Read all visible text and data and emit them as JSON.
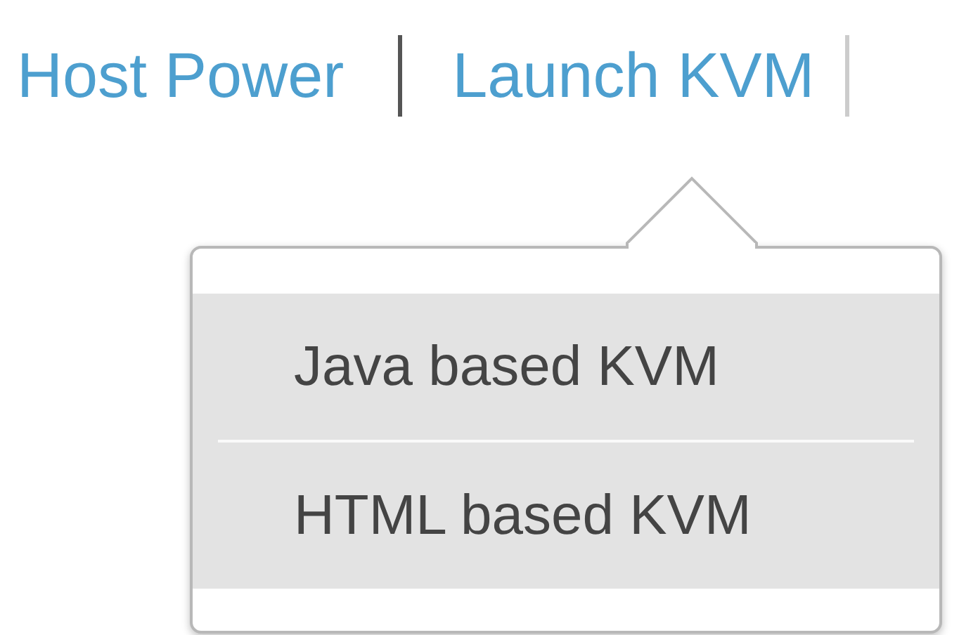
{
  "nav_links": [
    {
      "label": "Host Power"
    },
    {
      "label": "Launch KVM"
    }
  ],
  "dropdown_menu": {
    "items": [
      {
        "label": "Java based KVM"
      },
      {
        "label": "HTML based KVM"
      }
    ]
  }
}
